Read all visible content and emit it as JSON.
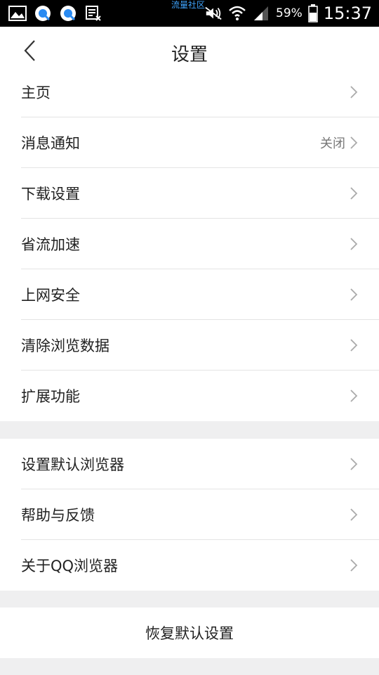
{
  "status_bar": {
    "carrier_text": "流量社区",
    "battery_percent": "59%",
    "time": "15:37",
    "icons": [
      "gallery-icon",
      "browser-icon",
      "browser-icon-2",
      "calendar-icon",
      "mute-icon",
      "wifi-icon",
      "signal-icon",
      "battery-icon"
    ]
  },
  "header": {
    "title": "设置",
    "back_icon": "chevron-left-icon"
  },
  "group1": [
    {
      "label": "主页",
      "value": ""
    },
    {
      "label": "消息通知",
      "value": "关闭"
    },
    {
      "label": "下载设置",
      "value": ""
    },
    {
      "label": "省流加速",
      "value": ""
    },
    {
      "label": "上网安全",
      "value": ""
    },
    {
      "label": "清除浏览数据",
      "value": ""
    },
    {
      "label": "扩展功能",
      "value": ""
    }
  ],
  "group2": [
    {
      "label": "设置默认浏览器"
    },
    {
      "label": "帮助与反馈"
    },
    {
      "label": "关于QQ浏览器"
    }
  ],
  "reset_label": "恢复默认设置",
  "colors": {
    "background": "#efeff0",
    "card": "#ffffff",
    "text": "#222222",
    "secondary": "#777777",
    "status_bar": "#000000"
  }
}
